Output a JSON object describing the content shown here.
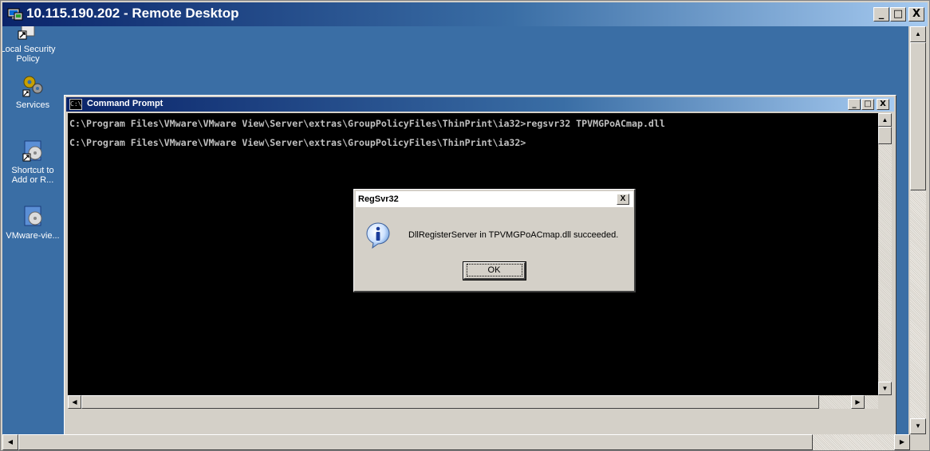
{
  "window": {
    "title": "10.115.190.202 - Remote Desktop",
    "minimize_label": "_",
    "restore_label": "□",
    "close_label": "X"
  },
  "desktop": {
    "icons": [
      {
        "label": "Local Security\nPolicy",
        "icon": "local-security-policy-icon"
      },
      {
        "label": "Services",
        "icon": "services-icon"
      },
      {
        "label": "Shortcut to\nAdd or R...",
        "icon": "add-remove-programs-icon"
      },
      {
        "label": "VMware-vie...",
        "icon": "vmware-installer-icon"
      }
    ]
  },
  "cmd": {
    "title": "Command Prompt",
    "icon_text": "C:\\",
    "lines": [
      "C:\\Program Files\\VMware\\VMware View\\Server\\extras\\GroupPolicyFiles\\ThinPrint\\ia32>regsvr32 TPVMGPoACmap.dll",
      "C:\\Program Files\\VMware\\VMware View\\Server\\extras\\GroupPolicyFiles\\ThinPrint\\ia32>"
    ]
  },
  "dialog": {
    "title": "RegSvr32",
    "message": "DllRegisterServer in TPVMGPoACmap.dll succeeded.",
    "ok_label": "OK",
    "close_label": "X",
    "icon": "information-icon"
  },
  "colors": {
    "desktop": "#3a6ea5",
    "titlebar_active": "#0a246a",
    "console_bg": "#000000",
    "console_fg": "#c0c0c0"
  }
}
